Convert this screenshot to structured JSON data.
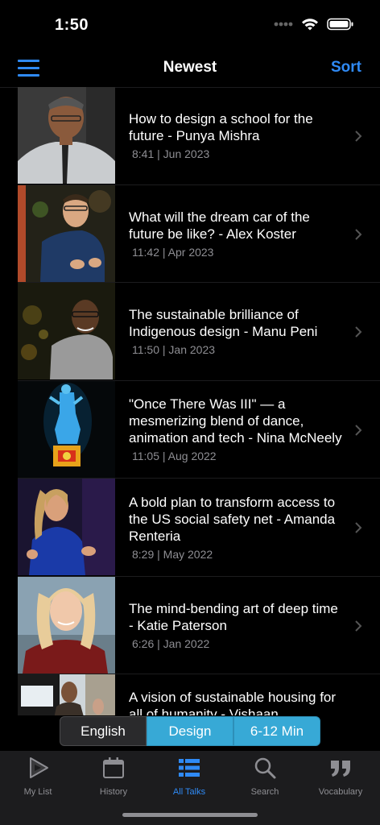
{
  "status": {
    "time": "1:50"
  },
  "nav": {
    "title": "Newest",
    "sort_label": "Sort"
  },
  "talks": [
    {
      "title": "How to design a school for the future - Punya Mishra",
      "meta": "8:41 | Jun 2023"
    },
    {
      "title": "What will the dream car of the future be like? - Alex Koster",
      "meta": "11:42 | Apr 2023"
    },
    {
      "title": "The sustainable brilliance of Indigenous design - Manu Peni",
      "meta": "11:50 | Jan 2023"
    },
    {
      "title": "\"Once There Was III\" — a mesmerizing blend of dance, animation and tech - Nina McNeely",
      "meta": "11:05 | Aug 2022"
    },
    {
      "title": "A bold plan to transform access to the US social safety net - Amanda Renteria",
      "meta": "8:29 | May 2022"
    },
    {
      "title": "The mind-bending art of deep time - Katie Paterson",
      "meta": "6:26 | Jan 2022"
    },
    {
      "title": "A vision of sustainable housing for all of humanity - Vishaan",
      "meta": ""
    }
  ],
  "filters": {
    "language": "English",
    "topic": "Design",
    "duration": "6-12 Min"
  },
  "tabs": [
    {
      "label": "My List",
      "icon": "play-outline-icon"
    },
    {
      "label": "History",
      "icon": "calendar-icon"
    },
    {
      "label": "All Talks",
      "icon": "list-icon"
    },
    {
      "label": "Search",
      "icon": "search-icon"
    },
    {
      "label": "Vocabulary",
      "icon": "quote-icon"
    }
  ],
  "colors": {
    "accent": "#2f8af5",
    "filter_active": "#37a9d6"
  }
}
